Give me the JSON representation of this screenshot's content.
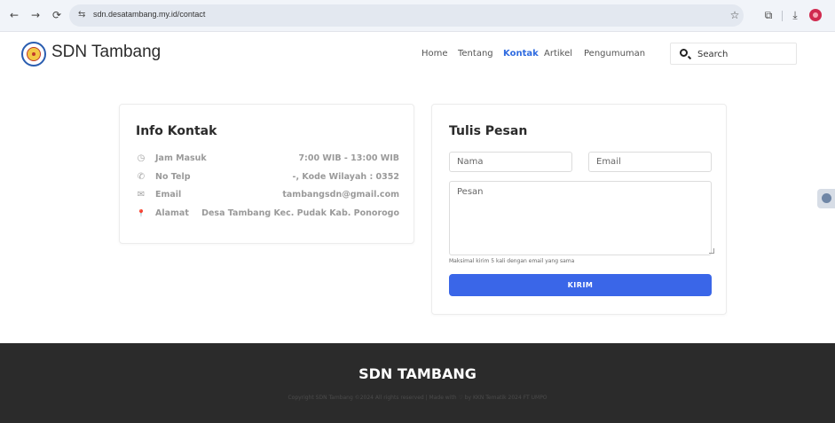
{
  "browser": {
    "url": "sdn.desatambang.my.id/contact",
    "back_icon": "←",
    "forward_icon": "→",
    "reload_icon": "⟳",
    "site_info_icon": "⇆",
    "bookmark_icon": "☆",
    "extensions_icon": "⧉",
    "download_icon": "⤓"
  },
  "header": {
    "site_title": "SDN Tambang",
    "nav": {
      "home": "Home",
      "tentang": "Tentang",
      "kontak": "Kontak",
      "artikel": "Artikel",
      "pengumuman": "Pengumuman"
    },
    "search_placeholder": "Search"
  },
  "info_kontak": {
    "title": "Info Kontak",
    "rows": [
      {
        "icon": "◷",
        "label": "Jam Masuk",
        "value": "7:00 WIB - 13:00 WIB"
      },
      {
        "icon": "✆",
        "label": "No Telp",
        "value": "-, Kode Wilayah : 0352"
      },
      {
        "icon": "✉",
        "label": "Email",
        "value": "tambangsdn@gmail.com"
      },
      {
        "icon": "📍",
        "label": "Alamat",
        "value": "Desa Tambang Kec. Pudak Kab. Ponorogo"
      }
    ]
  },
  "tulis_pesan": {
    "title": "Tulis Pesan",
    "nama_placeholder": "Nama",
    "email_placeholder": "Email",
    "pesan_placeholder": "Pesan",
    "hint": "Maksimal kirim 5 kali dengan email yang sama",
    "submit_label": "KIRIM"
  },
  "footer": {
    "title": "SDN TAMBANG",
    "copyright": "Copyright SDN Tambang ©2024 All rights reserved | Made with ♡ by KKN Tematik 2024 FT UMPO"
  },
  "colors": {
    "accent": "#3a66e8",
    "nav_active": "#2f6be0",
    "footer_bg": "#2b2b2b"
  }
}
